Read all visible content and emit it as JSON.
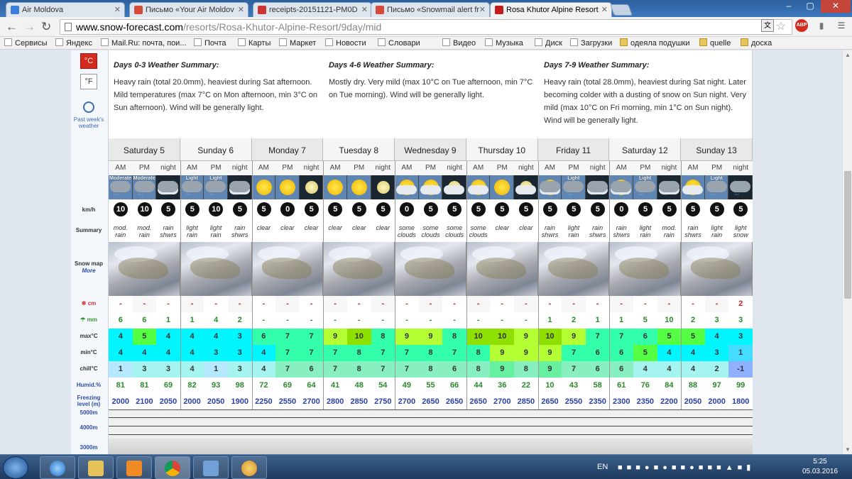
{
  "browser": {
    "tabs": [
      {
        "label": "Air Moldova",
        "color": "#3b7dd8"
      },
      {
        "label": "Письмо «Your Air Moldov",
        "color": "#d64a3a"
      },
      {
        "label": "receipts-20151121-PM0D",
        "color": "#c33"
      },
      {
        "label": "Письмо «Snowmail alert fr",
        "color": "#d64a3a"
      },
      {
        "label": "Rosa Khutor Alpine Resort",
        "color": "#c31a1a"
      }
    ],
    "url_domain": "www.snow-forecast.com",
    "url_path": "/resorts/Rosa-Khutor-Alpine-Resort/9day/mid",
    "bookmarks": [
      {
        "label": "Сервисы",
        "icon": "apps"
      },
      {
        "label": "Яндекс",
        "icon": "yandex"
      },
      {
        "label": "Mail.Ru: почта, пои...",
        "icon": "mail"
      },
      {
        "label": "Почта",
        "icon": "page"
      },
      {
        "label": "Карты",
        "icon": "page"
      },
      {
        "label": "Маркет",
        "icon": "page"
      },
      {
        "label": "Новости",
        "icon": "page"
      },
      {
        "label": "Словари",
        "icon": "page"
      },
      {
        "label": "Видео",
        "icon": "page"
      },
      {
        "label": "Музыка",
        "icon": "page"
      },
      {
        "label": "Диск",
        "icon": "page"
      },
      {
        "label": "Загрузки",
        "icon": "download"
      },
      {
        "label": "одеяла подушки",
        "icon": "folder"
      },
      {
        "label": "quelle",
        "icon": "folder"
      },
      {
        "label": "доска",
        "icon": "folder"
      }
    ],
    "abp": "ABP"
  },
  "units": {
    "celsius": "°C",
    "fahrenheit": "°F"
  },
  "past_weather": "Past week's weather",
  "row_labels": {
    "kmh": "km/h",
    "summary": "Summary",
    "snow_map": "Snow map",
    "more": "More",
    "cm": "cm",
    "mm": "mm",
    "max": "max°C",
    "min": "min°C",
    "chill": "chill°C",
    "humid": "Humid.%",
    "freezing": "Freezing level (m)",
    "alt_5000": "5000m",
    "alt_4000": "4000m",
    "alt_3000": "3000m"
  },
  "summaries": [
    {
      "title": "Days 0-3 Weather Summary:",
      "text": "Heavy rain (total 20.0mm), heaviest during Sat afternoon. Mild temperatures (max 7°C on Mon afternoon, min 3°C on Sun afternoon). Wind will be generally light."
    },
    {
      "title": "Days 4-6 Weather Summary:",
      "text": "Mostly dry. Very mild (max 10°C on Tue afternoon, min 7°C on Tue morning). Wind will be generally light."
    },
    {
      "title": "Days 7-9 Weather Summary:",
      "text": "Heavy rain (total 28.0mm), heaviest during Sat night. Later becoming colder with a dusting of snow on Sun night. Very mild (max 10°C on Fri morning, min 1°C on Sun night). Wind will be generally light."
    }
  ],
  "days": [
    "Saturday 5",
    "Sunday 6",
    "Monday 7",
    "Tuesday 8",
    "Wednesday 9",
    "Thursday 10",
    "Friday 11",
    "Saturday 12",
    "Sunday 13"
  ],
  "tod": [
    "AM",
    "PM",
    "night"
  ],
  "forecast": {
    "icons": [
      "moderate-rain",
      "moderate-rain",
      "moon-cloud-rain",
      "light-rain",
      "light-rain",
      "cloud-rain",
      "sun",
      "sun",
      "moon",
      "sun",
      "sun",
      "moon",
      "sun-cloud",
      "sun-cloud",
      "moon-cloud",
      "sun-cloud",
      "sun",
      "moon-cloud",
      "sun-cloud-rain",
      "light-rain",
      "moon-cloud-rain",
      "sun-cloud-rain",
      "light-rain",
      "cloud-rain",
      "sun-cloud",
      "light-rain",
      "snow-night"
    ],
    "icon_text": [
      "Moderate",
      "Moderate",
      "",
      "Light",
      "Light",
      "",
      "",
      "",
      "",
      "",
      "",
      "",
      "",
      "",
      "",
      "",
      "",
      "",
      "",
      "Light",
      "",
      "",
      "Light",
      "",
      "",
      "Light",
      ""
    ],
    "wind": [
      "10",
      "10",
      "5",
      "5",
      "10",
      "5",
      "5",
      "0",
      "5",
      "5",
      "5",
      "5",
      "0",
      "5",
      "5",
      "5",
      "5",
      "5",
      "5",
      "5",
      "5",
      "0",
      "5",
      "5",
      "5",
      "5",
      "5"
    ],
    "summary": [
      "mod. rain",
      "mod. rain",
      "rain shwrs",
      "light rain",
      "light rain",
      "rain shwrs",
      "clear",
      "clear",
      "clear",
      "clear",
      "clear",
      "clear",
      "some clouds",
      "some clouds",
      "some clouds",
      "some clouds",
      "clear",
      "clear",
      "rain shwrs",
      "light rain",
      "rain shwrs",
      "rain shwrs",
      "light rain",
      "mod. rain",
      "rain shwrs",
      "light rain",
      "light snow"
    ],
    "cm": [
      "-",
      "-",
      "-",
      "-",
      "-",
      "-",
      "-",
      "-",
      "-",
      "-",
      "-",
      "-",
      "-",
      "-",
      "-",
      "-",
      "-",
      "-",
      "-",
      "-",
      "-",
      "-",
      "-",
      "-",
      "-",
      "-",
      "2"
    ],
    "mm": [
      "6",
      "6",
      "1",
      "1",
      "4",
      "2",
      "-",
      "-",
      "-",
      "-",
      "-",
      "-",
      "-",
      "-",
      "-",
      "-",
      "-",
      "-",
      "1",
      "2",
      "1",
      "1",
      "5",
      "10",
      "2",
      "3",
      "3"
    ],
    "max": [
      "4",
      "5",
      "4",
      "4",
      "4",
      "3",
      "6",
      "7",
      "7",
      "9",
      "10",
      "8",
      "9",
      "9",
      "8",
      "10",
      "10",
      "9",
      "10",
      "9",
      "7",
      "7",
      "6",
      "5",
      "5",
      "4",
      "3"
    ],
    "min": [
      "4",
      "4",
      "4",
      "4",
      "3",
      "3",
      "4",
      "7",
      "7",
      "7",
      "8",
      "7",
      "7",
      "8",
      "7",
      "8",
      "9",
      "9",
      "9",
      "7",
      "6",
      "6",
      "5",
      "4",
      "4",
      "3",
      "1"
    ],
    "chill": [
      "1",
      "3",
      "3",
      "4",
      "1",
      "3",
      "4",
      "7",
      "6",
      "7",
      "8",
      "7",
      "7",
      "8",
      "6",
      "8",
      "9",
      "8",
      "9",
      "7",
      "6",
      "6",
      "4",
      "4",
      "4",
      "2",
      "-1"
    ],
    "humid": [
      "81",
      "81",
      "69",
      "82",
      "93",
      "98",
      "72",
      "69",
      "64",
      "41",
      "48",
      "54",
      "49",
      "55",
      "66",
      "44",
      "36",
      "22",
      "10",
      "43",
      "58",
      "61",
      "76",
      "84",
      "88",
      "97",
      "99"
    ],
    "freezing": [
      "2000",
      "2100",
      "2050",
      "2000",
      "2050",
      "1900",
      "2250",
      "2550",
      "2700",
      "2800",
      "2850",
      "2750",
      "2700",
      "2650",
      "2650",
      "2650",
      "2700",
      "2850",
      "2650",
      "2550",
      "2350",
      "2300",
      "2350",
      "2200",
      "2050",
      "2000",
      "1800"
    ]
  },
  "taskbar": {
    "lang": "EN",
    "time": "5:25",
    "date": "05.03.2016"
  }
}
